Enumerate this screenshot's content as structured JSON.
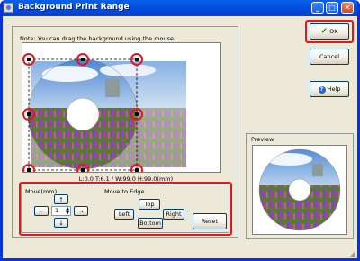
{
  "window": {
    "title": "Background Print Range"
  },
  "titlebar_buttons": {
    "minimize": "_",
    "maximize": "□",
    "close": "✕"
  },
  "note": "Note: You can drag the background using the mouse.",
  "coords": "L:0.0 T:6.1 / W:99.0 H:99.0(mm)",
  "move": {
    "label": "Move(mm)",
    "up": "↑",
    "down": "↓",
    "left": "←",
    "right": "→",
    "value": "1"
  },
  "move_to_edge": {
    "label": "Move to Edge",
    "top": "Top",
    "left": "Left",
    "right": "Right",
    "bottom": "Bottom"
  },
  "buttons": {
    "reset": "Reset",
    "ok": "OK",
    "cancel": "Cancel",
    "help": "Help"
  },
  "preview": {
    "label": "Preview"
  },
  "colors": {
    "highlight": "#e0181f",
    "title_bar": "#0053e1",
    "dialog": "#ece9d8"
  },
  "icons": {
    "ok": "checkmark-icon",
    "help": "help-icon"
  }
}
